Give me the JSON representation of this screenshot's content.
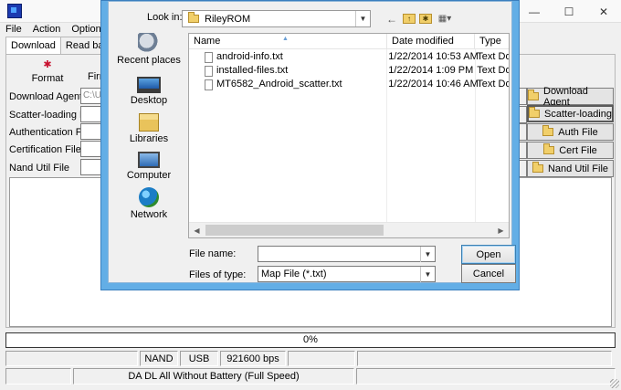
{
  "app": {
    "window_controls": [
      "—",
      "☐",
      "✕"
    ],
    "menu": [
      "File",
      "Action",
      "Options"
    ],
    "tabs": [
      "Download",
      "Read back"
    ],
    "toolbar": {
      "format_label": "Format",
      "firmware_label": "Firm"
    },
    "fields": [
      {
        "label": "Download Agent",
        "value": "C:\\U"
      },
      {
        "label": "Scatter-loading File",
        "value": ""
      },
      {
        "label": "Authentication File",
        "value": ""
      },
      {
        "label": "Certification File",
        "value": ""
      },
      {
        "label": "Nand Util File",
        "value": ""
      }
    ],
    "side_buttons": [
      "Download Agent",
      "Scatter-loading",
      "Auth File",
      "Cert File",
      "Nand Util File"
    ],
    "progress_text": "0%",
    "status": {
      "storage": "NAND",
      "connection": "USB",
      "baud": "921600 bps",
      "mode": "DA DL All Without Battery (Full Speed)"
    }
  },
  "dialog": {
    "look_in_label": "Look in:",
    "look_in_value": "RileyROM",
    "places": [
      "Recent places",
      "Desktop",
      "Libraries",
      "Computer",
      "Network"
    ],
    "columns": [
      "Name",
      "Date modified",
      "Type"
    ],
    "files": [
      {
        "name": "android-info.txt",
        "date": "1/22/2014 10:53 AM",
        "type": "Text Docu"
      },
      {
        "name": "installed-files.txt",
        "date": "1/22/2014 1:09 PM",
        "type": "Text Docu"
      },
      {
        "name": "MT6582_Android_scatter.txt",
        "date": "1/22/2014 10:46 AM",
        "type": "Text Docu"
      }
    ],
    "file_name_label": "File name:",
    "file_name_value": "",
    "files_of_type_label": "Files of type:",
    "files_of_type_value": "Map File (*.txt)",
    "open_label": "Open",
    "cancel_label": "Cancel"
  }
}
